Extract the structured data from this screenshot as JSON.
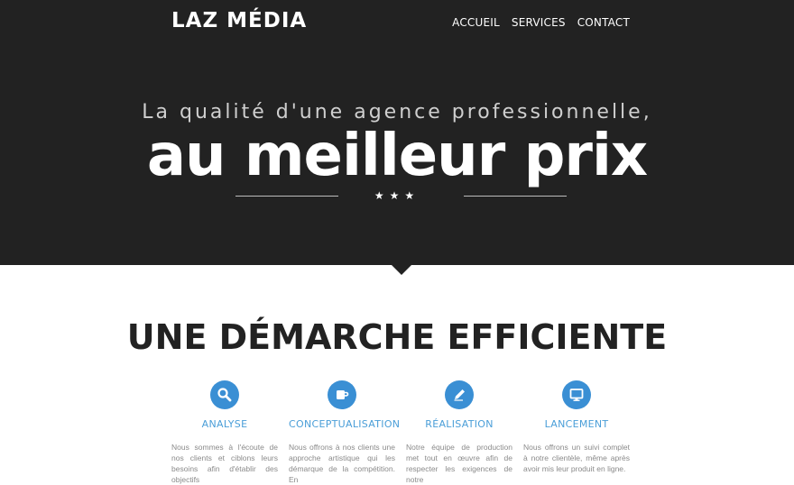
{
  "header": {
    "logo": "LAZ MÉDIA",
    "nav": [
      {
        "label": "ACCUEIL"
      },
      {
        "label": "SERVICES"
      },
      {
        "label": "CONTACT"
      }
    ]
  },
  "hero": {
    "tagline": "La qualité d'une agence professionnelle,",
    "headline": "au meilleur prix",
    "stars": "★★★"
  },
  "section": {
    "title": "UNE DÉMARCHE EFFICIENTE",
    "features": [
      {
        "icon": "search-icon",
        "title": "ANALYSE",
        "text": "Nous sommes à l'écoute de nos clients et ciblons leurs besoins afin d'établir des objectifs"
      },
      {
        "icon": "mug-icon",
        "title": "CONCEPTUALISATION",
        "text": "Nous offrons à nos clients une approche artistique qui les démarque de la compétition. En"
      },
      {
        "icon": "pencil-icon",
        "title": "RÉALISATION",
        "text": "Notre équipe de production met tout en œuvre afin de respecter les exigences de notre"
      },
      {
        "icon": "monitor-icon",
        "title": "LANCEMENT",
        "text": "Nous offrons un suivi complet à notre clientèle, même après avoir mis leur produit en ligne."
      }
    ]
  },
  "colors": {
    "hero_bg": "#222222",
    "accent": "#3a8fd4"
  }
}
